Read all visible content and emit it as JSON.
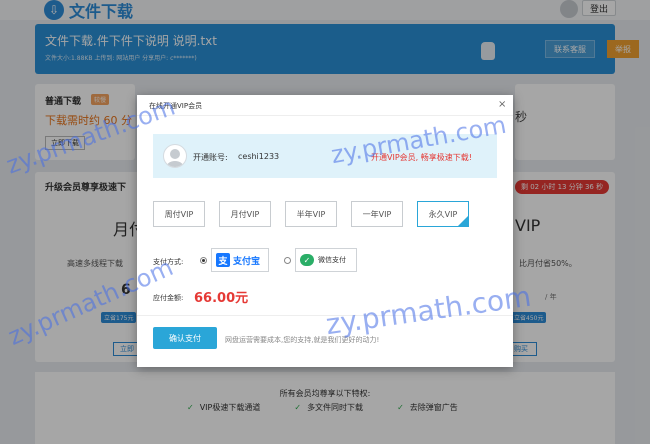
{
  "header": {
    "site_title": "文件下载",
    "logout_label": "登出"
  },
  "file": {
    "title": "文件下载.件下件下说明 说明.txt",
    "meta": "文件大小:1.88KB  上传到: 网站用户  分享用户: c*******)",
    "service_label": "联系客服",
    "report_label": "举报"
  },
  "normal_download": {
    "title": "普通下载",
    "badge": "较慢",
    "time_text": "下载需时约 60 分",
    "button_label": "立即下载"
  },
  "right_card": {
    "text": "秒"
  },
  "vip_section": {
    "title": "升级会员尊享极速下",
    "countdown": "剩 02 小时 13 分钟 36 秒",
    "left_plan": {
      "title": "月付",
      "desc": "高速多线程下载",
      "price": "6",
      "save": "立省175元",
      "button_label": "立即"
    },
    "right_plan": {
      "title": "VIP",
      "desc": "比月付省50%。",
      "unit": "/ 年",
      "save": "立省450元",
      "button_label": "购买"
    }
  },
  "privileges": {
    "title": "所有会员均尊享以下特权:",
    "items": [
      "VIP极速下载通道",
      "多文件同时下载",
      "去除弹窗广告"
    ]
  },
  "modal": {
    "title": "在线开通VIP会员",
    "close": "×",
    "account_label": "开通账号:",
    "account_user": "ceshi1233",
    "promo": "开通VIP会员, 畅享极速下载!",
    "plans": [
      "周付VIP",
      "月付VIP",
      "半年VIP",
      "一年VIP",
      "永久VIP"
    ],
    "selected_plan": "永久VIP",
    "pay_method_label": "支付方式:",
    "alipay_icon": "支",
    "alipay_label": "支付宝",
    "wechat_icon": "✓",
    "wechat_label": "微信支付",
    "amount_label": "应付金额:",
    "amount": "66.00元",
    "confirm_label": "确认支付",
    "support_text": "网盘运营需要成本,您的支持,就是我们更好的动力!"
  },
  "watermark": "zy.prmath.com",
  "colors": {
    "primary": "#2aa6d8",
    "price_red": "#e53935",
    "banner_blue": "#2a8fd6",
    "report_orange": "#f0a030"
  }
}
